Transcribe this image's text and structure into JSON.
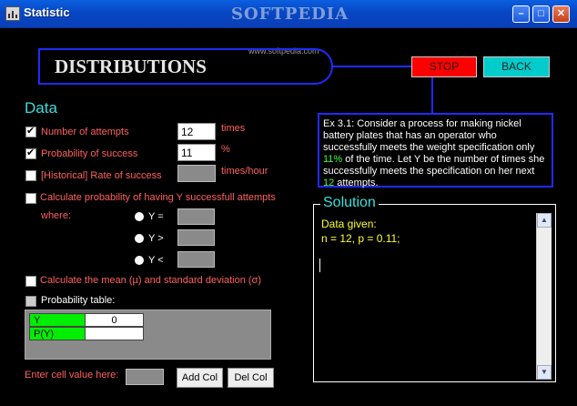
{
  "window": {
    "title": "Statistic",
    "watermark": "SOFTPEDIA",
    "watermark_url": "www.softpedia.com",
    "controls": {
      "minimize": "–",
      "maximize": "□",
      "close": "✕"
    }
  },
  "header": {
    "title": "DISTRIBUTIONS",
    "stop_label": "STOP",
    "back_label": "BACK"
  },
  "data_section": {
    "title": "Data",
    "attempts": {
      "label": "Number of attempts",
      "value": "12",
      "unit": "times",
      "checked": true
    },
    "probability": {
      "label": "Probability of success",
      "value": "11",
      "unit": "%",
      "checked": true
    },
    "rate": {
      "label": "[Historical] Rate of success",
      "unit": "times/hour",
      "checked": false
    },
    "calc_prob": {
      "label": "Calculate probability of having Y successfull attempts",
      "where": "where:",
      "checked": false
    },
    "radios": [
      {
        "label": "Y ="
      },
      {
        "label": "Y >"
      },
      {
        "label": "Y <"
      }
    ],
    "mean_sd": {
      "label": "Calculate the mean (µ) and standard deviation (σ)",
      "checked": false
    },
    "prob_table": {
      "label": "Probability table:",
      "checked": false
    },
    "table": {
      "row1_header": "Y",
      "row2_header": "P(Y)",
      "cell_value": "0"
    },
    "cell_entry_label": "Enter cell value here:",
    "add_col_label": "Add Col",
    "del_col_label": "Del Col"
  },
  "example": {
    "text_1": "Ex 3.1: Consider a process for making nickel battery plates that has an operator who successfully meets the weight specification only ",
    "highlight_1": "11%",
    "text_2": " of the time. Let Y be the number of times she successfully meets the specification on her next ",
    "highlight_2": "12",
    "text_3": " attempts."
  },
  "solution": {
    "title": "Solution",
    "line_1": "Data given:",
    "line_2": "n = 12, p = 0.11;"
  },
  "colors": {
    "accent_blue": "#1e2cff",
    "label_red": "#ff6060",
    "cyan": "#3bdede",
    "solution_yellow": "#ffff33",
    "highlight_green": "#3cff3c"
  }
}
